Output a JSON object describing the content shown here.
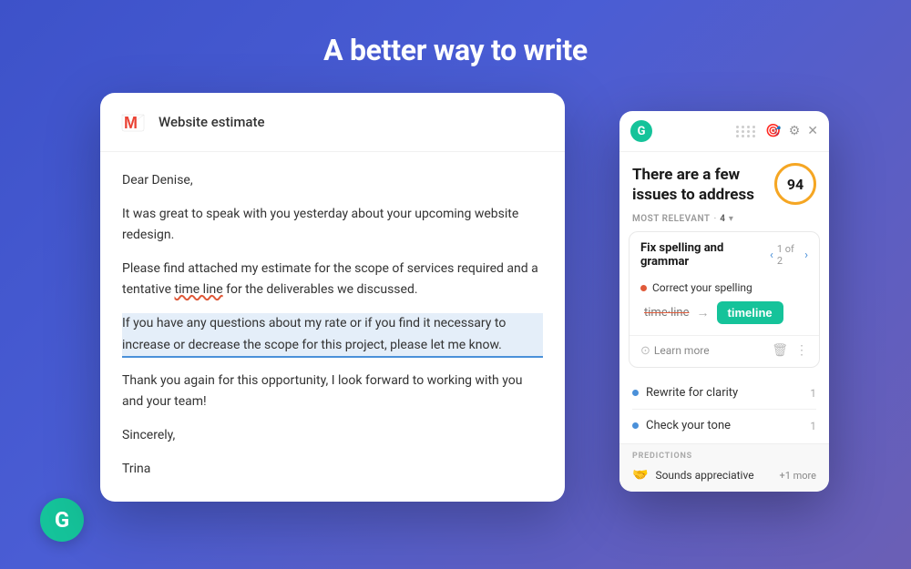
{
  "page": {
    "title": "A better way to write",
    "background_color": "#4a5dd4"
  },
  "email": {
    "subject": "Website estimate",
    "body": {
      "greeting": "Dear Denise,",
      "para1": "It was great to speak with you yesterday about your upcoming website redesign.",
      "para2_pre": "Please find attached my estimate for the scope of services required and a tentative ",
      "para2_wrong": "time line",
      "para2_post": " for the deliverables we discussed.",
      "para3": "If you have any questions about my rate or if you find it necessary to increase or decrease the scope for this project, please let me know.",
      "para4": "Thank you again for this opportunity, I look forward to working with you and your team!",
      "closing": "Sincerely,",
      "name": "Trina"
    }
  },
  "grammarly_panel": {
    "score": "94",
    "title_line1": "There are a few",
    "title_line2": "issues to address",
    "most_relevant_label": "MOST RELEVANT",
    "most_relevant_count": "4",
    "issue_card": {
      "title": "Fix spelling and grammar",
      "nav": "1 of 2",
      "sub_label": "Correct your spelling",
      "wrong_word": "time·line",
      "correct_word": "timeline",
      "learn_more": "Learn more"
    },
    "other_issues": [
      {
        "text": "Rewrite for clarity",
        "count": "1"
      },
      {
        "text": "Check your tone",
        "count": "1"
      }
    ],
    "predictions": {
      "label": "PREDICTIONS",
      "item": "Sounds appreciative",
      "more": "+1 more"
    }
  }
}
